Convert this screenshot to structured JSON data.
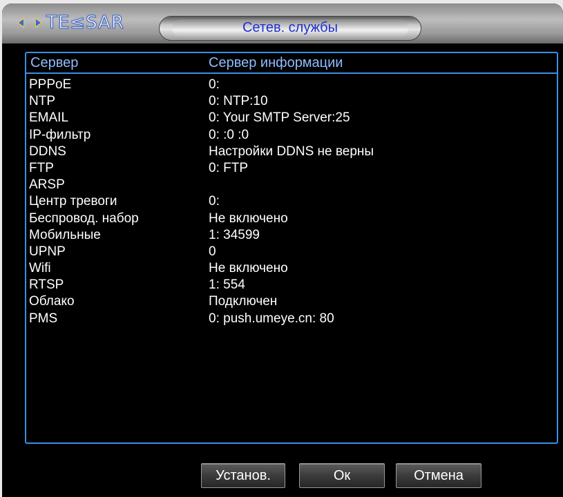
{
  "window": {
    "logo_text": "TE≤SAR",
    "title": "Сетев. службы"
  },
  "table": {
    "headers": [
      "Сервер",
      "Сервер информации"
    ],
    "rows": [
      {
        "name": "PPPoE",
        "info": "0:"
      },
      {
        "name": "NTP",
        "info": "0: NTP:10"
      },
      {
        "name": "EMAIL",
        "info": "0: Your SMTP Server:25"
      },
      {
        "name": "IP-фильтр",
        "info": "0: :0 :0"
      },
      {
        "name": "DDNS",
        "info": "Настройки DDNS не верны"
      },
      {
        "name": "FTP",
        "info": "0: FTP"
      },
      {
        "name": "ARSP",
        "info": ""
      },
      {
        "name": "Центр тревоги",
        "info": "0:"
      },
      {
        "name": "Беспровод. набор",
        "info": "Не включено"
      },
      {
        "name": "Мобильные",
        "info": "1: 34599"
      },
      {
        "name": "UPNP",
        "info": "0"
      },
      {
        "name": "Wifi",
        "info": "Не включено"
      },
      {
        "name": "RTSP",
        "info": "1: 554"
      },
      {
        "name": "Облако",
        "info": "Подключен"
      },
      {
        "name": "PMS",
        "info": "0: push.umeye.cn: 80"
      }
    ]
  },
  "buttons": {
    "apply": "Установ.",
    "ok": "Ок",
    "cancel": "Отмена"
  },
  "colors": {
    "accent": "#3a8ee6",
    "title_text": "#1c2fd0",
    "header_text": "#8fbcff"
  }
}
